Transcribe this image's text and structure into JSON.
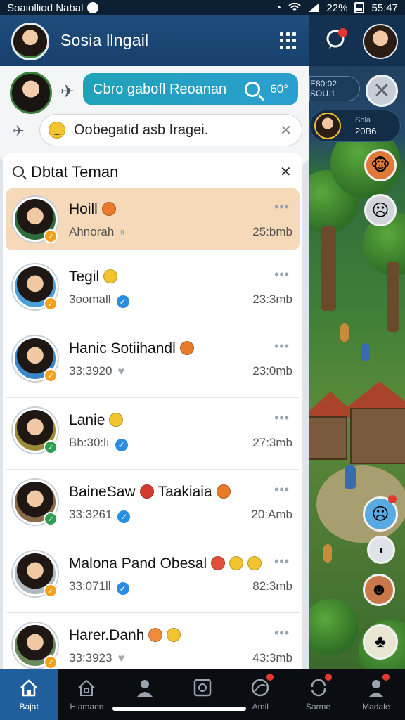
{
  "status_bar": {
    "carrier": "Soaiolliod Nabal",
    "battery": "22%",
    "time": "55:47"
  },
  "header": {
    "title": "Sosia llngail",
    "menu_icon": "grid-icon"
  },
  "compose": {
    "search_text": "Cbro gabofl Reoanan",
    "search_extra": "60°",
    "status_placeholder": "Oobegatid asb Iragei."
  },
  "friends": {
    "title": "Dbtat Teman",
    "rows": [
      {
        "name": "Hoill",
        "sub": "Ahnorah",
        "time": "25:bmb",
        "badge_color": "#f3a01c",
        "emoji_colors": [
          "#e87a2a"
        ],
        "sub_icon": "pause-icon"
      },
      {
        "name": "Tegil",
        "sub": "3oomall",
        "time": "23:3mb",
        "badge_color": "#f3a01c",
        "emoji_colors": [
          "#f4c430"
        ],
        "sub_icon": "verified-icon"
      },
      {
        "name": "Hanic Sotiihandl",
        "sub": "33:3920",
        "time": "23:0mb",
        "badge_color": "#f3a01c",
        "emoji_colors": [
          "#e87a2a"
        ],
        "sub_icon": "heart-icon"
      },
      {
        "name": "Lanie",
        "sub": "Bb:30:lı",
        "time": "27:3mb",
        "badge_color": "#2e9e4f",
        "emoji_colors": [
          "#f4c430"
        ],
        "sub_icon": "verified-icon"
      },
      {
        "name": "BaineSaw",
        "name2": "Taakiaia",
        "sub": "33:3261",
        "time": "20:Amb",
        "badge_color": "#2e9e4f",
        "emoji_colors": [
          "#d63a2f",
          "#e87a2a"
        ],
        "sub_icon": "verified-icon"
      },
      {
        "name": "Malona Pand Obesal",
        "sub": "33:071ll",
        "time": "82:3mb",
        "badge_color": "#f3a01c",
        "emoji_colors": [
          "#e0503a",
          "#f4c430",
          "#f4c430"
        ],
        "sub_icon": "verified-icon"
      },
      {
        "name": "Harer.Danh",
        "sub": "33:3923",
        "time": "43:3mb",
        "badge_color": "#f3a01c",
        "emoji_colors": [
          "#f08a3a",
          "#f4c430"
        ],
        "sub_icon": "heart-icon"
      }
    ]
  },
  "right_panel": {
    "pill_line1": "E80:02",
    "pill_line2": "SOU.1",
    "pill2_line1": "Sola",
    "pill2_line2": "20B6"
  },
  "bottom_nav": [
    {
      "label": "Bajat",
      "icon": "home-icon",
      "active": true
    },
    {
      "label": "Hlamaen",
      "icon": "house-outline-icon",
      "active": false
    },
    {
      "label": "",
      "icon": "person-icon",
      "active": false
    },
    {
      "label": "",
      "icon": "square-icon",
      "active": false
    },
    {
      "label": "Amil",
      "icon": "chat-icon",
      "active": false,
      "dot": true
    },
    {
      "label": "Sarme",
      "icon": "sync-icon",
      "active": false,
      "dot": true
    },
    {
      "label": "Madale",
      "icon": "profile-icon",
      "active": false,
      "dot": true
    }
  ]
}
